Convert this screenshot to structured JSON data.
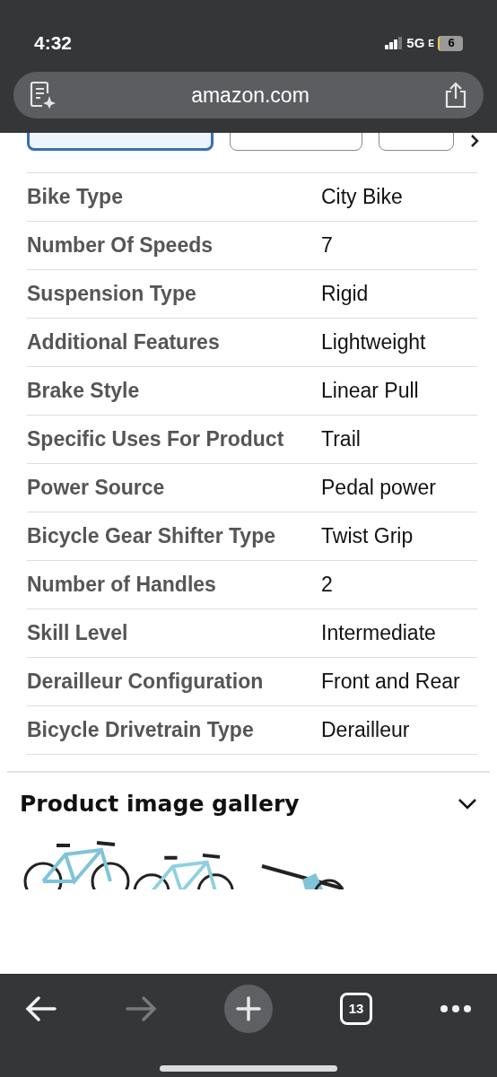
{
  "status_bar": {
    "time": "4:32",
    "network": "5G",
    "network_suffix": "E",
    "battery": "6"
  },
  "address_bar": {
    "url": "amazon.com"
  },
  "spec_tabs": [
    {
      "selected": true
    },
    {
      "selected": false
    },
    {
      "selected": false
    }
  ],
  "specs": [
    {
      "label": "Bike Type",
      "value": "City Bike"
    },
    {
      "label": "Number Of Speeds",
      "value": "7"
    },
    {
      "label": "Suspension Type",
      "value": "Rigid"
    },
    {
      "label": "Additional Features",
      "value": "Lightweight"
    },
    {
      "label": "Brake Style",
      "value": "Linear Pull"
    },
    {
      "label": "Specific Uses For Product",
      "value": "Trail"
    },
    {
      "label": "Power Source",
      "value": "Pedal power"
    },
    {
      "label": "Bicycle Gear Shifter Type",
      "value": "Twist Grip"
    },
    {
      "label": "Number of Handles",
      "value": "2"
    },
    {
      "label": "Skill Level",
      "value": "Intermediate"
    },
    {
      "label": "Derailleur Configuration",
      "value": "Front and Rear"
    },
    {
      "label": "Bicycle Drivetrain Type",
      "value": "Derailleur"
    }
  ],
  "gallery": {
    "title": "Product image gallery",
    "expanded": false
  },
  "toolbar": {
    "tab_count": "13",
    "forward_disabled": true
  }
}
